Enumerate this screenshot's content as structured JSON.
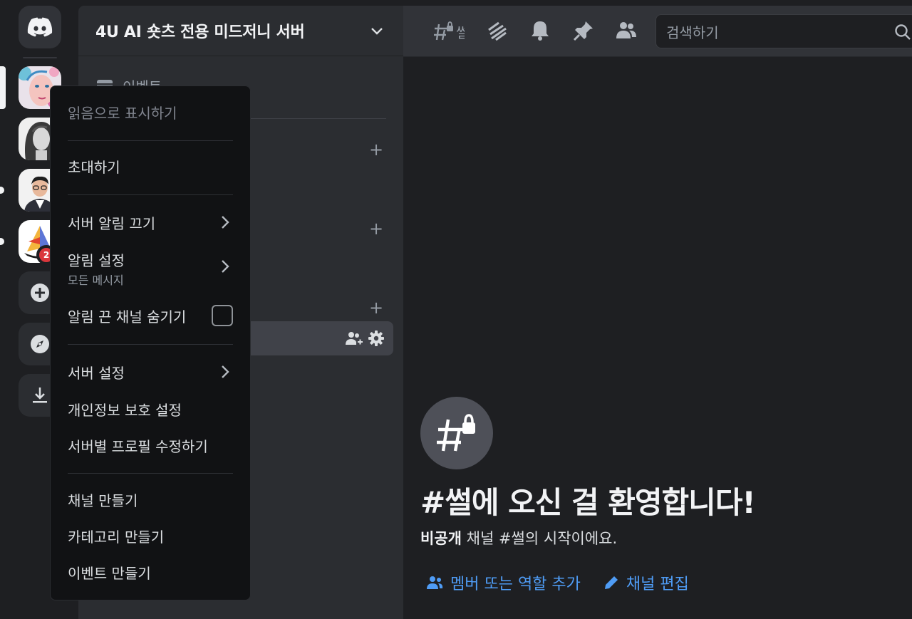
{
  "server": {
    "name": "4U AI 숏츠 전용 미드저니 서버"
  },
  "sidebar": {
    "events_label": "이벤트"
  },
  "rail": {
    "badge_count": "2"
  },
  "topbar": {
    "channel_name_fragment": "썰",
    "search_placeholder": "검색하기"
  },
  "context_menu": {
    "mark_read": "읽음으로 표시하기",
    "invite": "초대하기",
    "mute_server": "서버 알림 끄기",
    "notification_settings": "알림 설정",
    "notification_settings_sub": "모든 메시지",
    "hide_muted_channels": "알림 끈 채널 숨기기",
    "server_settings": "서버 설정",
    "privacy_settings": "개인정보 보호 설정",
    "edit_server_profile": "서버별 프로필 수정하기",
    "create_channel": "채널 만들기",
    "create_category": "카테고리 만들기",
    "create_event": "이벤트 만들기"
  },
  "welcome": {
    "title": "#썰에 오신 걸 환영합니다!",
    "subtitle_bold": "비공개",
    "subtitle_rest": " 채널 #썰의 시작이에요.",
    "add_members_link": "멤버 또는 역할 추가",
    "edit_channel_link": "채널 편집"
  },
  "colors": {
    "accent_link": "#4f9cf5",
    "badge": "#da373c",
    "discord_blurple": "#5865f2"
  }
}
